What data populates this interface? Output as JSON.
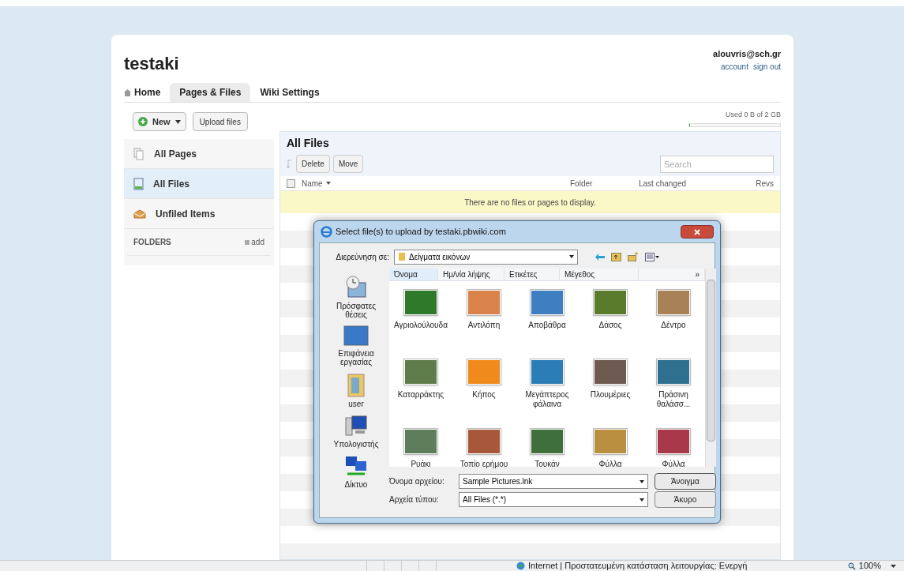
{
  "wiki": {
    "title": "testaki",
    "user": "alouvris@sch.gr",
    "links": [
      "account",
      "sign out"
    ]
  },
  "tabs": [
    {
      "label": "Home",
      "kind": "home",
      "selected": false
    },
    {
      "label": "Pages & Files",
      "kind": "plain",
      "selected": true
    },
    {
      "label": "Wiki Settings",
      "kind": "plain",
      "selected": false
    }
  ],
  "toolbar": {
    "new": "New",
    "upload": "Upload files"
  },
  "usage": {
    "text": "Used 0 B of 2 GB",
    "level": 0.01
  },
  "sidebar": {
    "items": [
      {
        "label": "All Pages",
        "kind": "pages",
        "selected": false
      },
      {
        "label": "All Files",
        "kind": "files",
        "selected": true
      },
      {
        "label": "Unfiled Items",
        "kind": "unfiled",
        "selected": false
      }
    ],
    "folders": "FOLDERS",
    "add": "add"
  },
  "files": {
    "title": "All Files",
    "actions": [
      "Delete",
      "Move"
    ],
    "search": {
      "placeholder": "Search"
    },
    "select_all": {
      "checked": false
    },
    "columns": [
      "Name",
      "Folder",
      "Last changed",
      "Revs"
    ],
    "empty": "There are no files or pages to display."
  },
  "dialog": {
    "title": "Select file(s) to upload by testaki.pbwiki.com",
    "look_in_label": "Διερεύνηση σε:",
    "look_in": "Δείγματα εικόνων",
    "places": [
      {
        "label": "Πρόσφατες θέσεις",
        "kind": "recent"
      },
      {
        "label": "Επιφάνεια εργασίας",
        "kind": "desktop"
      },
      {
        "label": "user",
        "kind": "user"
      },
      {
        "label": "Υπολογιστής",
        "kind": "computer"
      },
      {
        "label": "Δίκτυο",
        "kind": "network"
      }
    ],
    "columns": [
      "Όνομα",
      "Ημ/νία λήψης",
      "Ετικέτες",
      "Μέγεθος",
      "»"
    ],
    "items": [
      {
        "name": "Αγριολούλουδα",
        "color": "#2f7a2a"
      },
      {
        "name": "Αντιλόπη",
        "color": "#d9824a"
      },
      {
        "name": "Αποβάθρα",
        "color": "#3d7fc0"
      },
      {
        "name": "Δάσος",
        "color": "#5a7a2c"
      },
      {
        "name": "Δέντρο",
        "color": "#a88256"
      },
      {
        "name": "Καταρράκτης",
        "color": "#5f7d4a"
      },
      {
        "name": "Κήπος",
        "color": "#f08a1c"
      },
      {
        "name": "Μεγάπτερος φάλαινα",
        "color": "#2a7db5"
      },
      {
        "name": "Πλουμέριες",
        "color": "#6f5a52"
      },
      {
        "name": "Πράσινη θαλάσσ...",
        "color": "#2f6f8f"
      },
      {
        "name": "Ρυάκι",
        "color": "#5e7d5a"
      },
      {
        "name": "Τοπίο ερήμου",
        "color": "#a8583a"
      },
      {
        "name": "Τουκάν",
        "color": "#3f6f3a"
      },
      {
        "name": "Φύλλα",
        "color": "#b89040"
      },
      {
        "name": "Φύλλα",
        "color": "#a8384a"
      }
    ],
    "file_name_label": "Όνομα αρχείου:",
    "file_name": "Sample Pictures.lnk",
    "file_type_label": "Αρχεία τύπου:",
    "file_type": "All Files (*.*)",
    "buttons": [
      "Άνοιγμα",
      "Άκυρο"
    ]
  },
  "status_bar": {
    "text": "Internet | Προστατευμένη κατάσταση λειτουργίας: Ενεργή",
    "zoom": "100%"
  }
}
